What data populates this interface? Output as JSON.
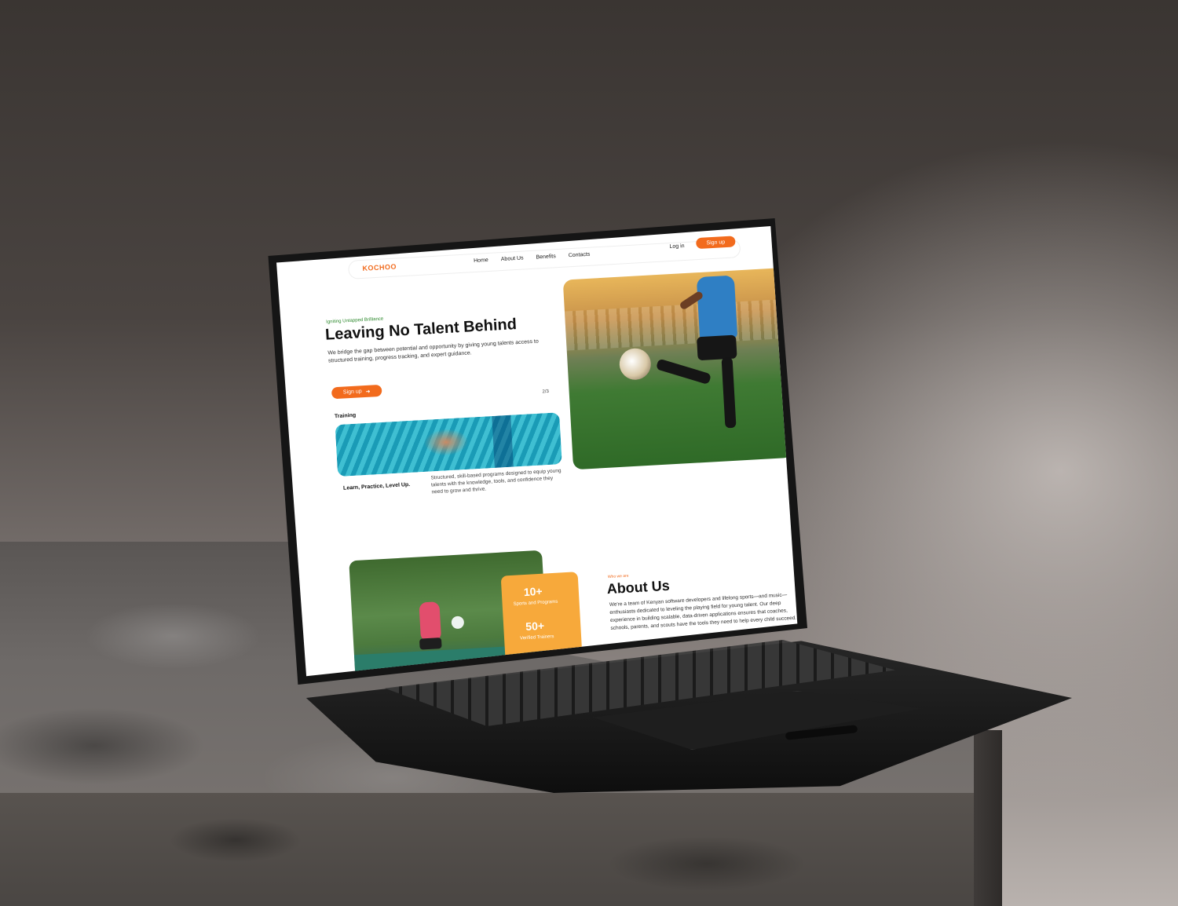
{
  "colors": {
    "accent": "#f26b1d",
    "accent_soft": "#f7a93b",
    "green": "#2e7d32"
  },
  "nav": {
    "logo": "KOCHOO",
    "links": [
      "Home",
      "About Us",
      "Benefits",
      "Contacts"
    ],
    "login": "Log in",
    "signup": "Sign up"
  },
  "hero": {
    "eyebrow": "Igniting Untapped Brilliance",
    "title": "Leaving No Talent Behind",
    "description": "We bridge the gap between potential and opportunity by giving young talents access to structured training, progress tracking, and expert guidance.",
    "cta": "Sign up",
    "cta_icon": "arrow-right-icon",
    "slide_counter": "2/3"
  },
  "training": {
    "label": "Training",
    "heading": "Learn, Practice, Level Up.",
    "description": "Structured, skill-based programs designed to equip young talents with the knowledge, tools, and confidence they need to grow and thrive."
  },
  "about": {
    "eyebrow": "Who we are",
    "title": "About Us",
    "description": "We're a team of Kenyan software developers and lifelong sports—and music—enthusiasts dedicated to leveling the playing field for young talent. Our deep experience in building scalable, data-driven applications ensures that coaches, schools, parents, and scouts have the tools they need to help every child succeed.",
    "stats": [
      {
        "value": "10+",
        "label": "Sports and Programs"
      },
      {
        "value": "50+",
        "label": "Verified Trainers"
      }
    ]
  }
}
